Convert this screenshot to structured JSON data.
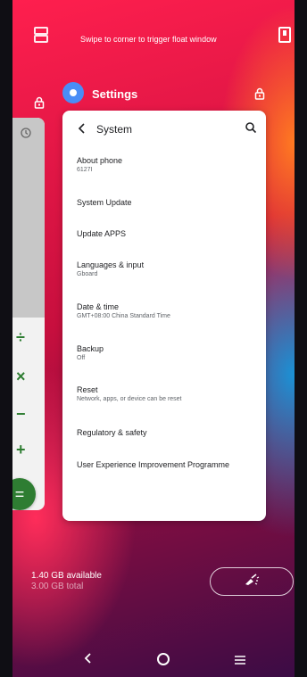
{
  "hint": "Swipe to corner to trigger float window",
  "app": {
    "name": "Settings",
    "icon": "settings-gear-icon",
    "accent": "#4a8df6"
  },
  "settings_page": {
    "title": "System",
    "items": [
      {
        "title": "About phone",
        "subtitle": "6127I"
      },
      {
        "title": "System Update",
        "subtitle": ""
      },
      {
        "title": "Update APPS",
        "subtitle": ""
      },
      {
        "title": "Languages & input",
        "subtitle": "Gboard"
      },
      {
        "title": "Date & time",
        "subtitle": "GMT+08:00 China Standard Time"
      },
      {
        "title": "Backup",
        "subtitle": "Off"
      },
      {
        "title": "Reset",
        "subtitle": "Network, apps, or device can be reset"
      },
      {
        "title": "Regulatory & safety",
        "subtitle": ""
      },
      {
        "title": "User Experience Improvement Programme",
        "subtitle": ""
      }
    ]
  },
  "calculator": {
    "ops": [
      "÷",
      "×",
      "−",
      "+"
    ],
    "equals": "=",
    "accent": "#2e7d32"
  },
  "memory": {
    "available": "1.40 GB available",
    "total": "3.00 GB total"
  },
  "icons": {
    "top_left": "split-screen-icon",
    "top_right": "float-window-icon",
    "lock": "lock-icon",
    "clear": "broom-clear-icon",
    "back": "chevron-left-icon",
    "search": "search-icon",
    "history": "history-icon"
  }
}
